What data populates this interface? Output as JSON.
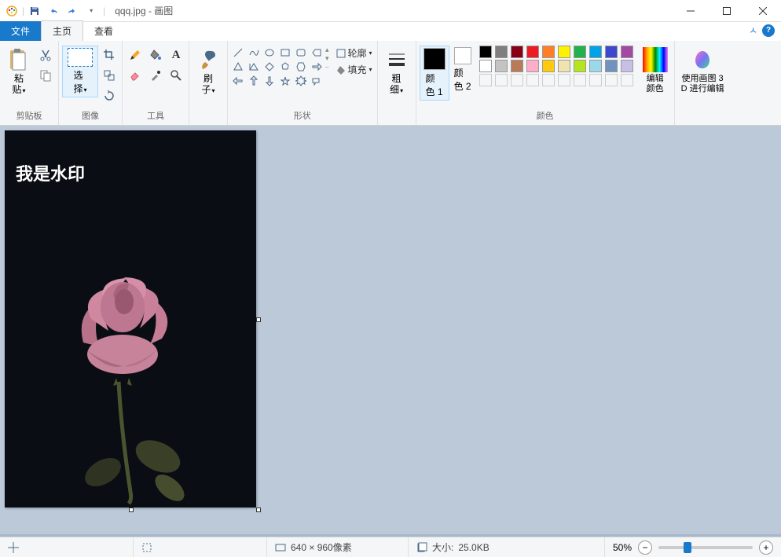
{
  "title": {
    "filename": "qqq.jpg",
    "app": "画图"
  },
  "tabs": {
    "file": "文件",
    "home": "主页",
    "view": "查看"
  },
  "ribbon": {
    "clipboard": {
      "paste": "粘\n贴",
      "label": "剪贴板"
    },
    "image": {
      "select": "选\n择",
      "label": "图像"
    },
    "tools": {
      "label": "工具"
    },
    "brush": {
      "label": "刷\n子"
    },
    "shapes": {
      "outline": "轮廓",
      "fill": "填充",
      "label": "形状"
    },
    "thickness": {
      "label": "粗\n细"
    },
    "color1": {
      "label": "颜\n色 1",
      "value": "#000000"
    },
    "color2": {
      "label": "颜\n色 2",
      "value": "#ffffff"
    },
    "colors_label": "颜色",
    "edit_colors": "编辑\n颜色",
    "paint3d": "使用画图 3\nD 进行编辑",
    "palette_row1": [
      "#000000",
      "#7f7f7f",
      "#880015",
      "#ed1c24",
      "#ff7f27",
      "#fff200",
      "#22b14c",
      "#00a2e8",
      "#3f48cc",
      "#a349a4"
    ],
    "palette_row2": [
      "#ffffff",
      "#c3c3c3",
      "#b97a57",
      "#ffaec9",
      "#ffc90e",
      "#efe4b0",
      "#b5e61d",
      "#99d9ea",
      "#7092be",
      "#c8bfe7"
    ]
  },
  "canvas": {
    "watermark": "我是水印"
  },
  "status": {
    "dimensions": "640 × 960像素",
    "size_label": "大小:",
    "size_value": "25.0KB",
    "zoom": "50%"
  }
}
